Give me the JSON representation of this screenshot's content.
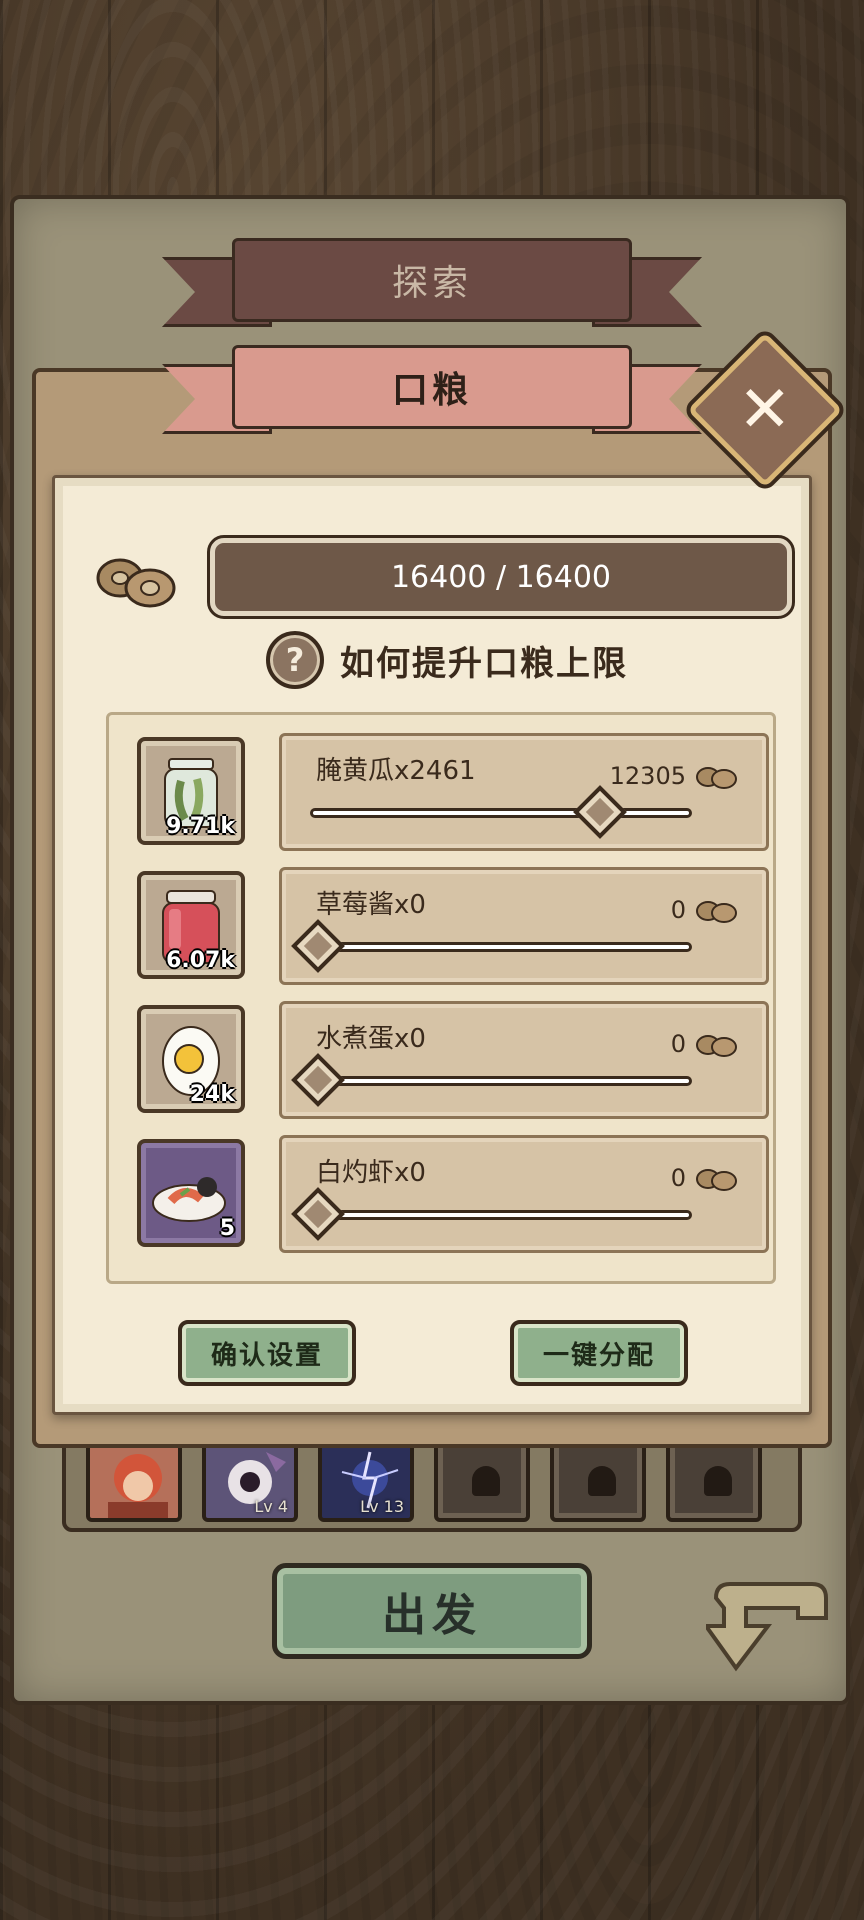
{
  "tabs": {
    "explore_label": "探索",
    "food_label": "口粮"
  },
  "close": {
    "label": "✕"
  },
  "rations": {
    "capacity_text": "16400 / 16400",
    "help_text": "如何提升口粮上限",
    "help_icon_label": "?"
  },
  "items": [
    {
      "name": "腌黄瓜x2461",
      "value": "12305",
      "stock": "9.71k",
      "slider_fraction": 0.75,
      "icon": "pickle-jar-icon"
    },
    {
      "name": "草莓酱x0",
      "value": "0",
      "stock": "6.07k",
      "slider_fraction": 0,
      "icon": "jam-jar-icon"
    },
    {
      "name": "水煮蛋x0",
      "value": "0",
      "stock": "24k",
      "slider_fraction": 0,
      "icon": "boiled-egg-icon"
    },
    {
      "name": "白灼虾x0",
      "value": "0",
      "stock": "5",
      "slider_fraction": 0,
      "icon": "shrimp-dish-icon"
    }
  ],
  "buttons": {
    "confirm_label": "确认设置",
    "auto_label": "一键分配",
    "depart_label": "出发"
  },
  "party": {
    "slot2_level": "Lv 4",
    "slot3_level": "Lv 13"
  },
  "colors": {
    "paper": "#f4ebd6",
    "green_button": "#8fb08c",
    "food_ribbon": "#d99a8e",
    "explore_ribbon": "#6b4a44"
  }
}
